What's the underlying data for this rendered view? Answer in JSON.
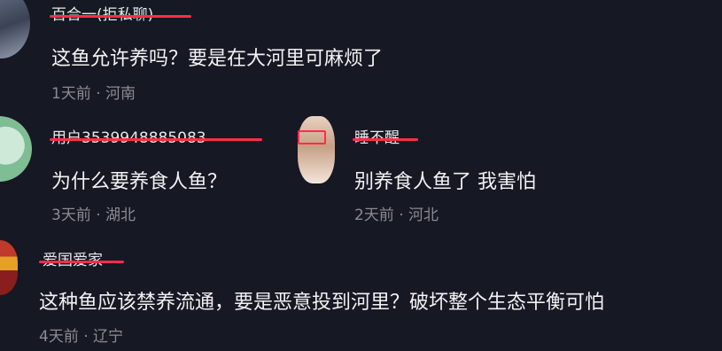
{
  "comments": [
    {
      "username": "百合一(拒私聊)",
      "text": "这鱼允许养吗？要是在大河里可麻烦了",
      "meta": "1天前 · 河南"
    },
    {
      "username": "用户3539948885083",
      "text": "为什么要养食人鱼？",
      "meta": "3天前 · 湖北"
    },
    {
      "username": "睡不醒",
      "text": "别养食人鱼了 我害怕",
      "meta": "2天前 · 河北"
    },
    {
      "username": "爱国爱家",
      "text": "这种鱼应该禁养流通，要是恶意投到河里？破坏整个生态平衡可怕",
      "meta": "4天前 · 辽宁"
    }
  ],
  "colors": {
    "background": "#161823",
    "redaction": "#ff2d4a",
    "text": "#f2f2f4",
    "meta": "#8a8b93"
  }
}
